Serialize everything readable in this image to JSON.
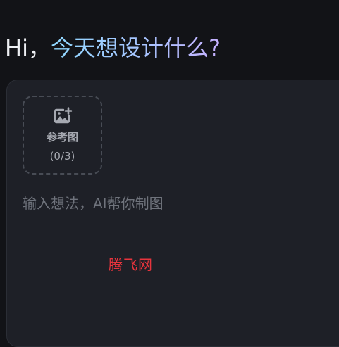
{
  "greeting": {
    "hi": "Hi，",
    "question": "今天想设计什么?"
  },
  "reference_upload": {
    "icon": "image-add-icon",
    "label": "参考图",
    "count": "(0/3)"
  },
  "prompt": {
    "value": "",
    "placeholder": "输入想法，AI帮你制图"
  },
  "watermark": {
    "text": "腾飞网"
  },
  "colors": {
    "background": "#121317",
    "panel": "#1e2027",
    "greeting_gradient_start": "#8fd8ff",
    "greeting_gradient_end": "#c6b1ff",
    "watermark": "#e8343d"
  }
}
